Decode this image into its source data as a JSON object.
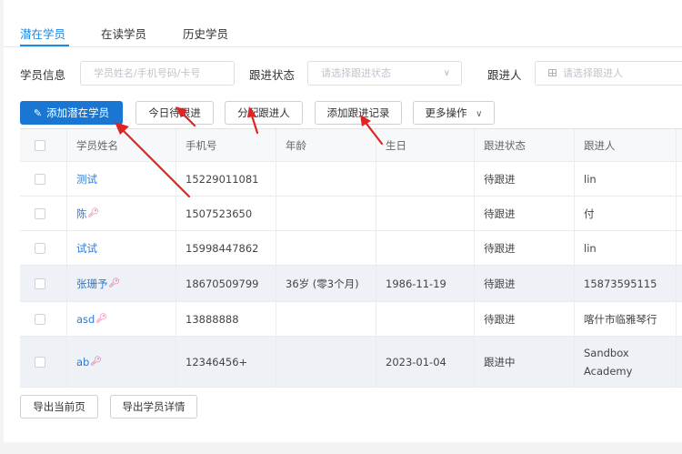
{
  "tabs": [
    "潜在学员",
    "在读学员",
    "历史学员"
  ],
  "filters": {
    "student_info_label": "学员信息",
    "student_info_placeholder": "学员姓名/手机号码/卡号",
    "status_label": "跟进状态",
    "status_placeholder": "请选择跟进状态",
    "follower_label": "跟进人",
    "follower_placeholder": "请选择跟进人"
  },
  "toolbar": {
    "add_label": "添加潜在学员",
    "today_label": "今日待跟进",
    "assign_label": "分配跟进人",
    "add_record_label": "添加跟进记录",
    "more_label": "更多操作"
  },
  "table": {
    "headers": [
      "学员姓名",
      "手机号",
      "年龄",
      "生日",
      "跟进状态",
      "跟进人"
    ],
    "rows": [
      {
        "name": "测试",
        "phone": "15229011081",
        "age": "",
        "birthday": "",
        "status": "待跟进",
        "follower": "lin",
        "key": false
      },
      {
        "name": "陈",
        "phone": "1507523650",
        "age": "",
        "birthday": "",
        "status": "待跟进",
        "follower": "付",
        "key": true
      },
      {
        "name": "试试",
        "phone": "15998447862",
        "age": "",
        "birthday": "",
        "status": "待跟进",
        "follower": "lin",
        "key": false
      },
      {
        "name": "张珊予",
        "phone": "18670509799",
        "age": "36岁 (零3个月)",
        "birthday": "1986-11-19",
        "status": "待跟进",
        "follower": "15873595115",
        "key": true
      },
      {
        "name": "asd",
        "phone": "13888888",
        "age": "",
        "birthday": "",
        "status": "待跟进",
        "follower": "喀什市临雅琴行",
        "key": true
      },
      {
        "name": "ab",
        "phone": "12346456+",
        "age": "",
        "birthday": "2023-01-04",
        "status": "跟进中",
        "follower": "Sandbox Academy",
        "key": true
      }
    ]
  },
  "footer": {
    "export_page_label": "导出当前页",
    "export_detail_label": "导出学员详情"
  },
  "icons": {
    "key": "key-icon",
    "pencil": "pencil-icon",
    "chevron": "chevron-down-icon"
  },
  "colors": {
    "primary": "#1976d2",
    "link": "#2a7bd6",
    "annotation_arrow": "#e02424"
  }
}
